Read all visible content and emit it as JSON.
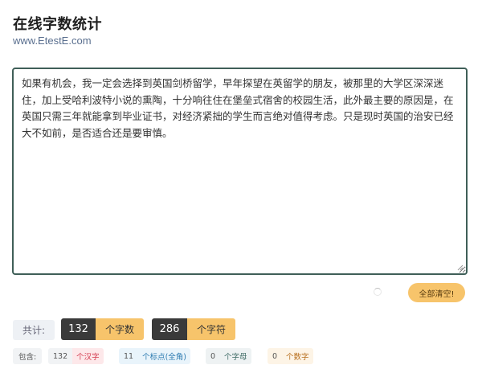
{
  "header": {
    "title": "在线字数统计",
    "subtitle": "www.EtestE.com"
  },
  "editor": {
    "text": "如果有机会，我一定会选择到英国剑桥留学，早年探望在英留学的朋友，被那里的大学区深深迷住，加上受哈利波特小说的熏陶，十分响往住在堡垒式宿舍的校园生活，此外最主要的原因是，在英国只需三年就能拿到毕业证书，对经济紧拙的学生而言绝对值得考虑。只是现时英国的治安已经大不如前，是否适合还是要审慎。"
  },
  "actions": {
    "clear_label": "全部清空!"
  },
  "totals": {
    "label": "共计:",
    "char_count": "132",
    "char_count_unit": "个字数",
    "symbol_count": "286",
    "symbol_count_unit": "个字符"
  },
  "details": {
    "label": "包含:",
    "hanzi_count": "132",
    "hanzi_unit": "个汉字",
    "punct_count": "11",
    "punct_unit": "个标点(全角)",
    "letter_count": "0",
    "letter_unit": "个字母",
    "digit_count": "0",
    "digit_unit": "个数字"
  },
  "colors": {
    "accent": "#f7c46b",
    "dark": "#3a3a3a",
    "editor_border": "#3f5f58"
  }
}
